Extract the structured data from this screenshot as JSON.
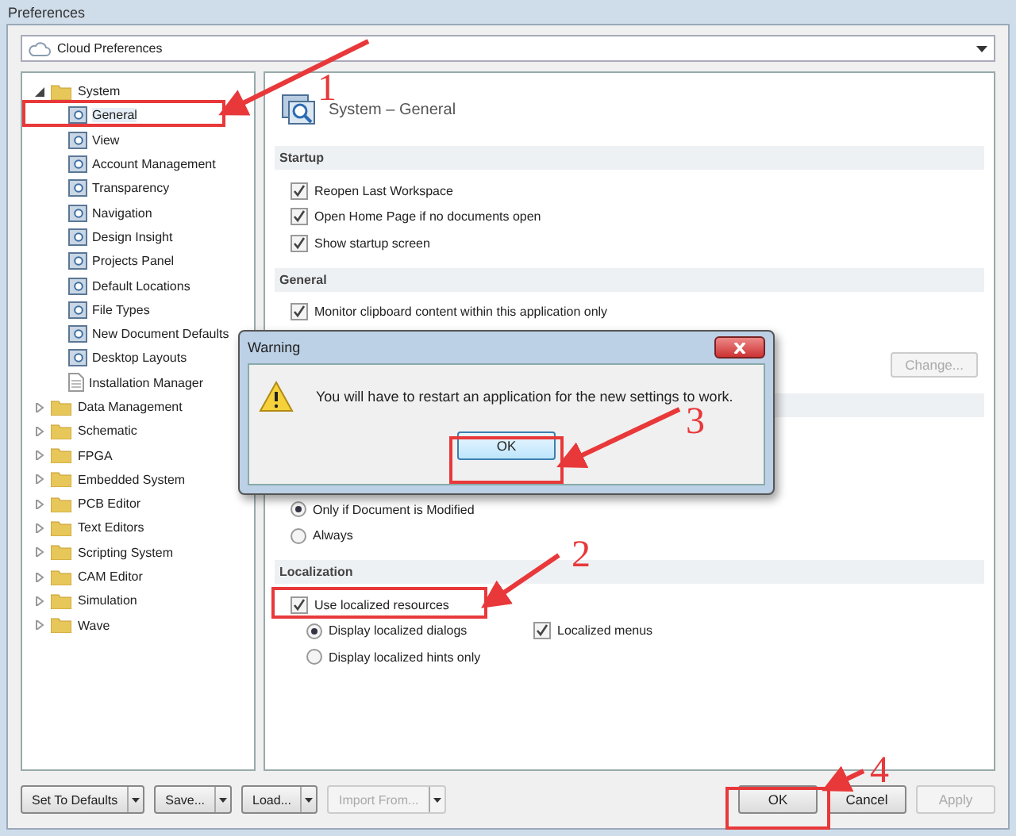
{
  "window": {
    "title": "Preferences"
  },
  "combo": {
    "value": "Cloud Preferences"
  },
  "tree": [
    {
      "label": "System",
      "expanded": true,
      "children": [
        {
          "label": "General",
          "selected": true,
          "kind": "settings"
        },
        {
          "label": "View",
          "selected": false,
          "kind": "settings"
        },
        {
          "label": "Account Management",
          "selected": false,
          "kind": "settings"
        },
        {
          "label": "Transparency",
          "selected": false,
          "kind": "settings"
        },
        {
          "label": "Navigation",
          "selected": false,
          "kind": "settings"
        },
        {
          "label": "Design Insight",
          "selected": false,
          "kind": "settings"
        },
        {
          "label": "Projects Panel",
          "selected": false,
          "kind": "settings"
        },
        {
          "label": "Default Locations",
          "selected": false,
          "kind": "settings"
        },
        {
          "label": "File Types",
          "selected": false,
          "kind": "settings"
        },
        {
          "label": "New Document Defaults",
          "selected": false,
          "kind": "settings"
        },
        {
          "label": "Desktop Layouts",
          "selected": false,
          "kind": "settings"
        },
        {
          "label": "Installation Manager",
          "selected": false,
          "kind": "page"
        }
      ]
    },
    {
      "label": "Data Management",
      "expanded": false
    },
    {
      "label": "Schematic",
      "expanded": false
    },
    {
      "label": "FPGA",
      "expanded": false
    },
    {
      "label": "Embedded System",
      "expanded": false
    },
    {
      "label": "PCB Editor",
      "expanded": false
    },
    {
      "label": "Text Editors",
      "expanded": false
    },
    {
      "label": "Scripting System",
      "expanded": false
    },
    {
      "label": "CAM Editor",
      "expanded": false
    },
    {
      "label": "Simulation",
      "expanded": false
    },
    {
      "label": "Wave",
      "expanded": false
    }
  ],
  "panel": {
    "title": "System – General",
    "sections": [
      {
        "title": "Startup",
        "options": [
          {
            "kind": "checkbox",
            "label": "Reopen Last Workspace",
            "checked": true
          },
          {
            "kind": "checkbox",
            "label": "Open Home Page if no documents open",
            "checked": true
          },
          {
            "kind": "checkbox",
            "label": "Show startup screen",
            "checked": true
          }
        ]
      },
      {
        "title": "General",
        "options": [
          {
            "kind": "checkbox",
            "label": "Monitor clipboard content within this application only",
            "checked": true
          },
          {
            "kind": "button",
            "label": "Change...",
            "disabled": true
          }
        ]
      },
      {
        "options": [
          {
            "kind": "radio",
            "label": "Only if Document is Modified",
            "selected": true
          },
          {
            "kind": "radio",
            "label": "Always",
            "selected": false
          }
        ]
      },
      {
        "title": "Localization",
        "options": [
          {
            "kind": "checkbox",
            "label": "Use localized resources",
            "checked": true,
            "children": [
              {
                "kind": "radio",
                "label": "Display localized dialogs",
                "selected": true,
                "aside": {
                  "label": "Localized menus",
                  "checked": true
                }
              },
              {
                "kind": "radio",
                "label": "Display localized hints only",
                "selected": false
              }
            ]
          }
        ]
      }
    ]
  },
  "dialog": {
    "title": "Warning",
    "message": "You will have to restart an application for the new settings to work.",
    "button": "OK"
  },
  "footer": {
    "left": [
      {
        "label": "Set To Defaults",
        "disabled": false
      },
      {
        "label": "Save...",
        "disabled": false
      },
      {
        "label": "Load...",
        "disabled": false
      },
      {
        "label": "Import From...",
        "disabled": true
      }
    ],
    "right": [
      {
        "label": "OK",
        "disabled": false
      },
      {
        "label": "Cancel",
        "disabled": false
      },
      {
        "label": "Apply",
        "disabled": true
      }
    ]
  },
  "annotations": [
    {
      "number": "1"
    },
    {
      "number": "2"
    },
    {
      "number": "3"
    },
    {
      "number": "4"
    }
  ]
}
